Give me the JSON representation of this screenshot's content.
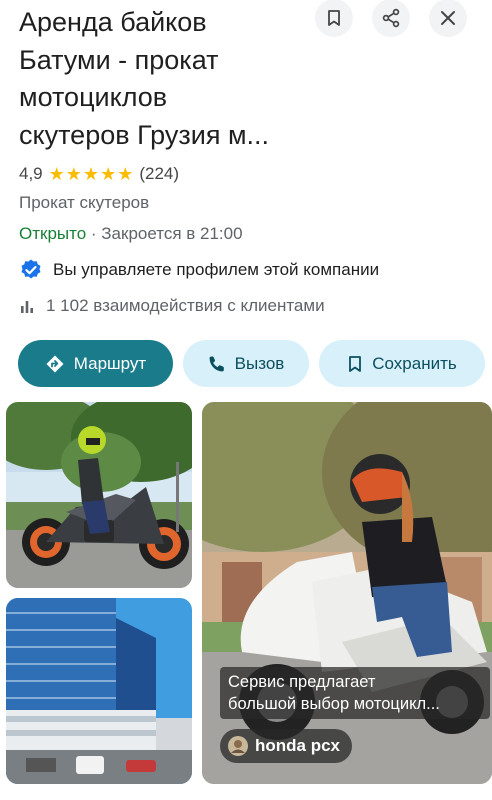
{
  "place": {
    "title_line1": "Аренда байков",
    "title_line2": "Батуми - прокат",
    "title_line3": "мотоциклов",
    "title_line4": "скутеров Грузия м...",
    "rating": "4,9",
    "review_count": "(224)",
    "category": "Прокат скутеров",
    "status_open": "Открыто",
    "status_separator": " · ",
    "closes_text": "Закроется в 21:00",
    "managed_text": "Вы управляете профилем этой компании",
    "interactions_text": "1 102 взаимодействия с клиентами"
  },
  "top_icons": [
    "bookmark-icon",
    "share-icon",
    "close-icon"
  ],
  "actions": {
    "route_label": "Маршрут",
    "call_label": "Вызов",
    "save_label": "Сохранить"
  },
  "photos": {
    "caption_line1": "Сервис предлагает",
    "caption_line2": "большой выбор мотоцикл...",
    "chip_label": "honda pcx"
  },
  "colors": {
    "star": "#fbbc04",
    "open_green": "#188038",
    "primary_teal": "#1a7c8b",
    "secondary_bg": "#d7f0fa",
    "verified_blue": "#1a73e8"
  }
}
